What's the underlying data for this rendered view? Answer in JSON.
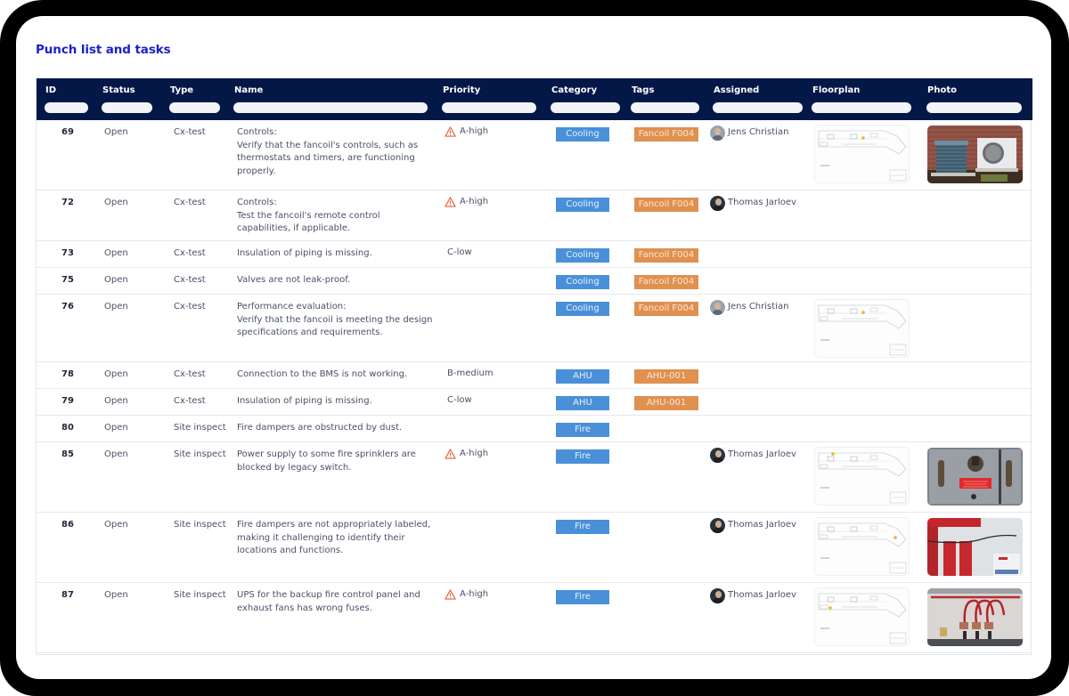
{
  "page": {
    "title": "Punch list and tasks"
  },
  "table": {
    "columns": [
      {
        "key": "id",
        "label": "ID"
      },
      {
        "key": "status",
        "label": "Status"
      },
      {
        "key": "type",
        "label": "Type"
      },
      {
        "key": "name",
        "label": "Name"
      },
      {
        "key": "priority",
        "label": "Priority"
      },
      {
        "key": "category",
        "label": "Category"
      },
      {
        "key": "tags",
        "label": "Tags"
      },
      {
        "key": "assigned",
        "label": "Assigned"
      },
      {
        "key": "floorplan",
        "label": "Floorplan"
      },
      {
        "key": "photo",
        "label": "Photo"
      }
    ],
    "filters": [
      "",
      "",
      "",
      "",
      "",
      "",
      "",
      "",
      "",
      ""
    ],
    "rows": [
      {
        "id": "69",
        "status": "Open",
        "type": "Cx-test",
        "name": [
          "Controls:",
          "Verify that the fancoil's controls, such as",
          "thermostats and timers, are functioning",
          "properly."
        ],
        "priority": "A-high",
        "priority_icon": "warning-icon",
        "category": "Cooling",
        "tag": "Fancoil F004",
        "assigned": "Jens Christian",
        "avatar": "jens",
        "floorplan": true,
        "photo": "outdoor-ac-units"
      },
      {
        "id": "72",
        "status": "Open",
        "type": "Cx-test",
        "name": [
          "Controls:",
          "Test the fancoil's remote control",
          "capabilities, if applicable."
        ],
        "priority": "A-high",
        "priority_icon": "warning-icon",
        "category": "Cooling",
        "tag": "Fancoil F004",
        "assigned": "Thomas Jarloev",
        "avatar": "thomas",
        "floorplan": false,
        "photo": null
      },
      {
        "id": "73",
        "status": "Open",
        "type": "Cx-test",
        "name": [
          "Insulation of piping is missing."
        ],
        "priority": "C-low",
        "priority_icon": null,
        "category": "Cooling",
        "tag": "Fancoil F004",
        "assigned": "",
        "avatar": null,
        "floorplan": false,
        "photo": null
      },
      {
        "id": "75",
        "status": "Open",
        "type": "Cx-test",
        "name": [
          "Valves are not leak-proof."
        ],
        "priority": "",
        "priority_icon": null,
        "category": "Cooling",
        "tag": "Fancoil F004",
        "assigned": "",
        "avatar": null,
        "floorplan": false,
        "photo": null
      },
      {
        "id": "76",
        "status": "Open",
        "type": "Cx-test",
        "name": [
          "Performance evaluation:",
          "Verify that the fancoil is meeting the design",
          "specifications and requirements."
        ],
        "priority": "",
        "priority_icon": null,
        "category": "Cooling",
        "tag": "Fancoil F004",
        "assigned": "Jens Christian",
        "avatar": "jens",
        "floorplan": true,
        "photo": null
      },
      {
        "id": "78",
        "status": "Open",
        "type": "Cx-test",
        "name": [
          "Connection to the BMS is not working."
        ],
        "priority": "B-medium",
        "priority_icon": null,
        "category": "AHU",
        "tag": "AHU-001",
        "assigned": "",
        "avatar": null,
        "floorplan": false,
        "photo": null
      },
      {
        "id": "79",
        "status": "Open",
        "type": "Cx-test",
        "name": [
          "Insulation of piping is missing."
        ],
        "priority": "C-low",
        "priority_icon": null,
        "category": "AHU",
        "tag": "AHU-001",
        "assigned": "",
        "avatar": null,
        "floorplan": false,
        "photo": null
      },
      {
        "id": "80",
        "status": "Open",
        "type": "Site inspect",
        "name": [
          "Fire dampers are obstructed by dust."
        ],
        "priority": "",
        "priority_icon": null,
        "category": "Fire",
        "tag": "",
        "assigned": "",
        "avatar": null,
        "floorplan": false,
        "photo": null
      },
      {
        "id": "85",
        "status": "Open",
        "type": "Site inspect",
        "name": [
          "Power supply to some fire sprinklers are",
          "blocked by legacy switch."
        ],
        "priority": "A-high",
        "priority_icon": "warning-icon",
        "category": "Fire",
        "tag": "",
        "assigned": "Thomas Jarloev",
        "avatar": "thomas",
        "floorplan": true,
        "photo": "switch-panel"
      },
      {
        "id": "86",
        "status": "Open",
        "type": "Site inspect",
        "name": [
          "Fire dampers are not appropriately labeled,",
          "making it challenging to identify their",
          "locations and functions."
        ],
        "priority": "",
        "priority_icon": null,
        "category": "Fire",
        "tag": "",
        "assigned": "Thomas Jarloev",
        "avatar": "thomas",
        "floorplan": true,
        "photo": "fire-suppression-room"
      },
      {
        "id": "87",
        "status": "Open",
        "type": "Site inspect",
        "name": [
          "UPS for the backup fire control panel and",
          "exhaust fans has wrong fuses."
        ],
        "priority": "A-high",
        "priority_icon": "warning-icon",
        "category": "Fire",
        "tag": "",
        "assigned": "Thomas Jarloev",
        "avatar": "thomas",
        "floorplan": true,
        "photo": "fuse-cabinet"
      }
    ]
  },
  "colors": {
    "title": "#1a1fc7",
    "header_bg": "#041848",
    "category_badge": "#4a90d9",
    "tag_badge": "#e0904f",
    "warning": "#e8623e"
  }
}
